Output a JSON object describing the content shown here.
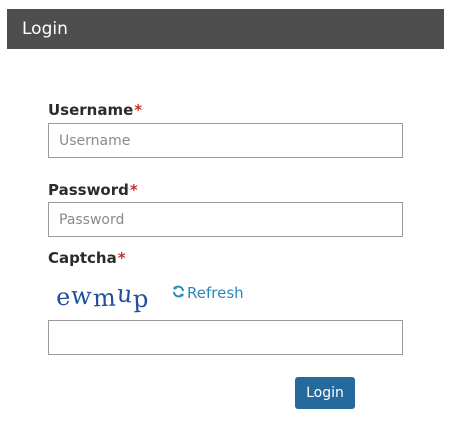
{
  "header": {
    "title": "Login"
  },
  "form": {
    "username": {
      "label": "Username",
      "required_mark": "*",
      "placeholder": "Username",
      "value": ""
    },
    "password": {
      "label": "Password",
      "required_mark": "*",
      "placeholder": "Password",
      "value": ""
    },
    "captcha": {
      "label": "Captcha",
      "required_mark": "*",
      "image_text": [
        "e",
        "w",
        "m",
        "u",
        "p"
      ],
      "refresh_label": "Refresh",
      "value": ""
    },
    "submit_label": "Login"
  },
  "colors": {
    "header_bg": "#4e4e4e",
    "required": "#c9302c",
    "link": "#2a88bd",
    "button": "#256a9d",
    "captcha_text": "#1f4f9a"
  },
  "icons": {
    "refresh": "refresh-icon"
  }
}
